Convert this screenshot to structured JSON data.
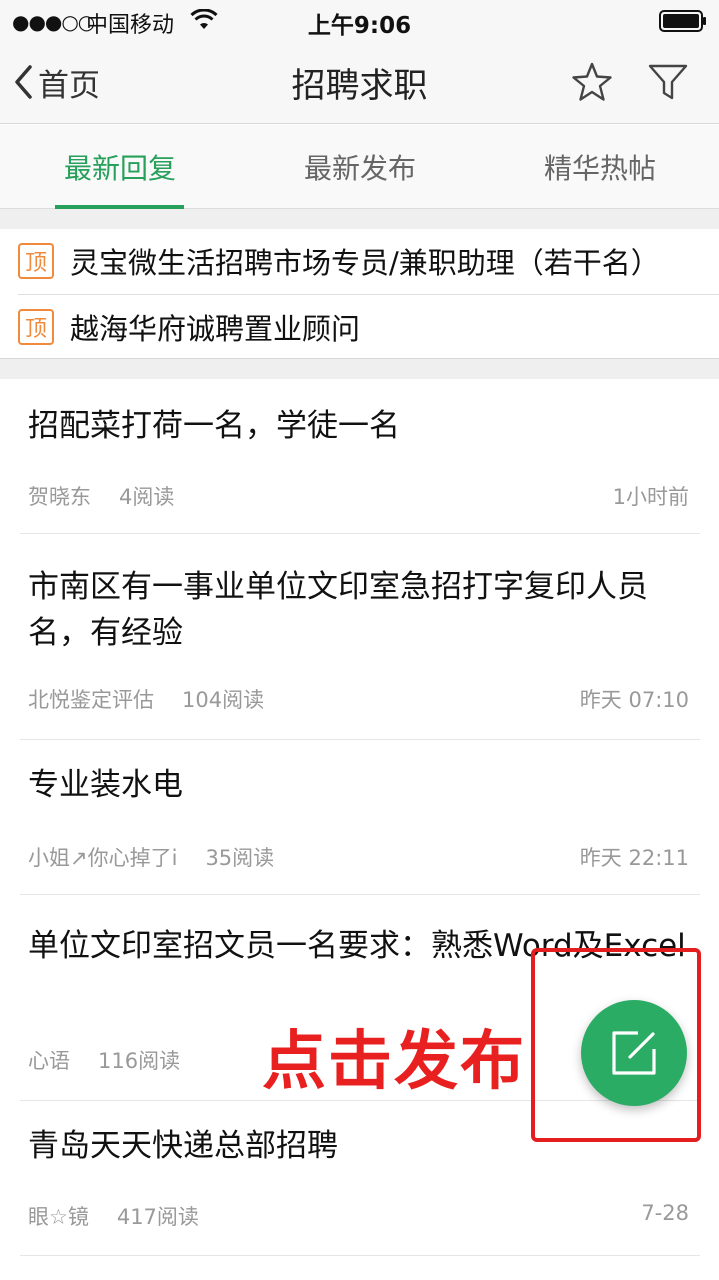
{
  "status_bar": {
    "signal": "●●●○○",
    "carrier": "中国移动",
    "time": "上午9:06"
  },
  "nav": {
    "back_label": "首页",
    "title": "招聘求职"
  },
  "tabs": [
    {
      "label": "最新回复",
      "active": true
    },
    {
      "label": "最新发布",
      "active": false
    },
    {
      "label": "精华热帖",
      "active": false
    }
  ],
  "pinned": [
    {
      "badge": "顶",
      "title": "灵宝微生活招聘市场专员/兼职助理（若干名）"
    },
    {
      "badge": "顶",
      "title": "越海华府诚聘置业顾问"
    }
  ],
  "posts": [
    {
      "title": "招配菜打荷一名，学徒一名",
      "author": "贺晓东",
      "reads": "4阅读",
      "time": "1小时前"
    },
    {
      "title": "市南区有一事业单位文印室急招打字复印人员名，有经验",
      "author": "北悦鉴定评估",
      "reads": "104阅读",
      "time": "昨天 07:10"
    },
    {
      "title": "专业装水电",
      "author": "小姐↗你心掉了i",
      "reads": "35阅读",
      "time": "昨天 22:11"
    },
    {
      "title": "单位文印室招文员一名要求：熟悉Word及Excel",
      "author": "心语",
      "reads": "116阅读",
      "time": ""
    },
    {
      "title": "青岛天天快递总部招聘",
      "author": "眼☆镜",
      "reads": "417阅读",
      "time": "7-28"
    }
  ],
  "annotation": {
    "text": "点击发布",
    "color": "#e82020"
  },
  "colors": {
    "accent": "#27a05b",
    "pin_badge": "#f08a3c",
    "fab": "#2aac64"
  }
}
